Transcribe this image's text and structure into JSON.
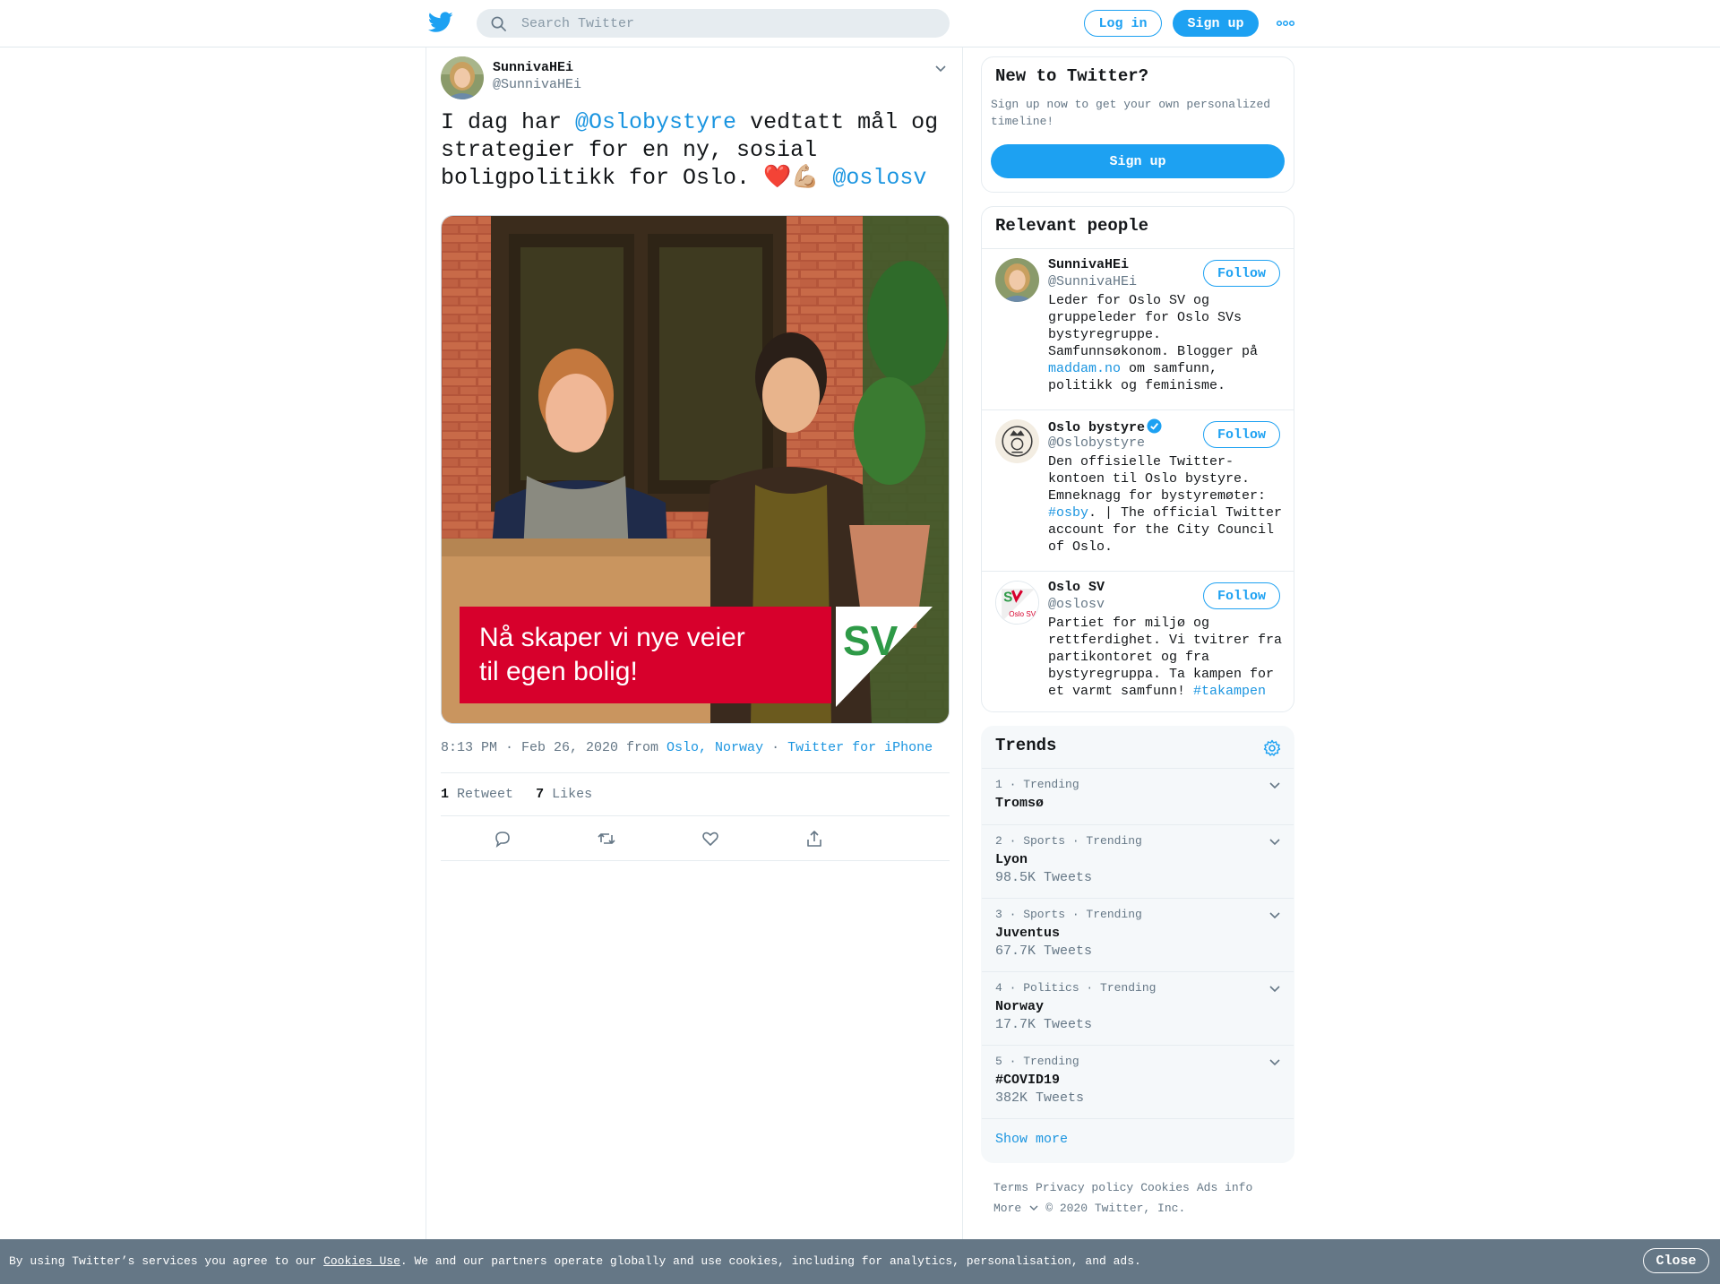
{
  "header": {
    "search_placeholder": "Search Twitter",
    "login_label": "Log in",
    "signup_label": "Sign up"
  },
  "tweet": {
    "author_name": "SunnivaHEi",
    "author_handle": "@SunnivaHEi",
    "text_part1": "I dag har ",
    "mention1": "@Oslobystyre",
    "text_part2": " vedtatt mål og strategier for en ny, sosial boligpolitikk for Oslo. ",
    "emoji_heart": "❤️",
    "emoji_muscle": "💪🏼",
    "mention2": "@oslosv",
    "image_caption_line1": "Nå skaper vi nye veier",
    "image_caption_line2": "til egen bolig!",
    "image_logo_text": "SV",
    "time": "8:13 PM · Feb 26, 2020 from ",
    "location": "Oslo, Norway",
    "separator": " · ",
    "source": "Twitter for iPhone",
    "retweets_count": "1",
    "retweets_label": "Retweet",
    "likes_count": "7",
    "likes_label": "Likes"
  },
  "new_to_twitter": {
    "title": "New to Twitter?",
    "subtitle": "Sign up now to get your own personalized timeline!",
    "signup_label": "Sign up"
  },
  "relevant_people": {
    "title": "Relevant people",
    "follow_label": "Follow",
    "people": [
      {
        "name": "SunnivaHEi",
        "handle": "@SunnivaHEi",
        "bio_part1": "Leder for Oslo SV og gruppeleder for Oslo SVs bystyregruppe. Samfunnsøkonom. Blogger på ",
        "bio_link": "maddam.no",
        "bio_part2": " om samfunn, politikk og feminisme."
      },
      {
        "name": "Oslo bystyre",
        "handle": "@Oslobystyre",
        "bio_part1": "Den offisielle Twitter-kontoen til Oslo bystyre. Emneknagg for bystyremøter: ",
        "bio_link": "#osby",
        "bio_part2": ". | The official Twitter account for the City Council of Oslo."
      },
      {
        "name": "Oslo SV",
        "handle": "@oslosv",
        "avatar_text": "Oslo SV",
        "bio_part1": "Partiet for miljø og rettferdighet. Vi tvitrer fra partikontoret og fra bystyregruppa. Ta kampen for et varmt samfunn! ",
        "bio_link": "#takampen",
        "bio_part2": ""
      }
    ]
  },
  "trends": {
    "title": "Trends",
    "items": [
      {
        "meta": "1 · Trending",
        "name": "Tromsø",
        "count": ""
      },
      {
        "meta": "2 · Sports · Trending",
        "name": "Lyon",
        "count": "98.5K Tweets"
      },
      {
        "meta": "3 · Sports · Trending",
        "name": "Juventus",
        "count": "67.7K Tweets"
      },
      {
        "meta": "4 · Politics · Trending",
        "name": "Norway",
        "count": "17.7K Tweets"
      },
      {
        "meta": "5 · Trending",
        "name": "#COVID19",
        "count": "382K Tweets"
      }
    ],
    "show_more": "Show more"
  },
  "footer": {
    "terms": "Terms",
    "privacy": "Privacy policy",
    "cookies": "Cookies",
    "ads": "Ads info",
    "more": "More",
    "copyright": "© 2020 Twitter, Inc."
  },
  "cookie_bar": {
    "text_before": "By using Twitter’s services you agree to our ",
    "link": "Cookies Use",
    "text_after": ". We and our partners operate globally and use cookies, including for analytics, personalisation, and ads.",
    "close_label": "Close"
  },
  "colors": {
    "brand": "#1da1f2",
    "link": "#1b95e0",
    "muted": "#657786",
    "cookie_bar": "#657786",
    "sv_red": "#d7002c",
    "sv_green": "#2e9a47"
  }
}
